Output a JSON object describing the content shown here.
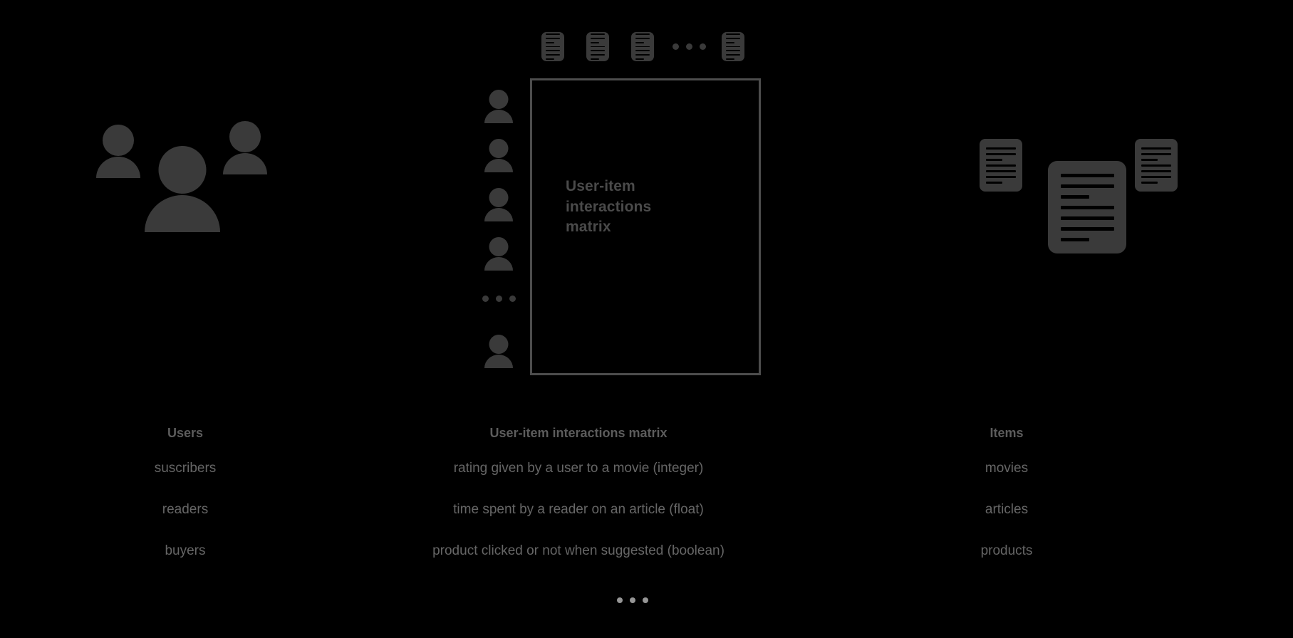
{
  "diagram": {
    "matrix": {
      "caption": "User-item interactions matrix"
    },
    "legend": {
      "headers": {
        "users": "Users",
        "matrix": "User-item interactions matrix",
        "items": "Items"
      },
      "rows": [
        {
          "users": "suscribers",
          "matrix": "rating given by a user to a movie (integer)",
          "items": "movies"
        },
        {
          "users": "readers",
          "matrix": "time spent by a reader on an article (float)",
          "items": "articles"
        },
        {
          "users": "buyers",
          "matrix": "product clicked or not when suggested (boolean)",
          "items": "products"
        }
      ]
    },
    "colors": {
      "background": "#000000",
      "icon_fill": "#3a3a3a",
      "matrix_border": "#4d4d4d",
      "heading_text": "#5c5c5c",
      "body_text": "#666666",
      "ellipsis_light": "#969696"
    },
    "icons": {
      "person": "person-icon",
      "document": "document-icon",
      "ellipsis": "ellipsis-icon"
    }
  }
}
